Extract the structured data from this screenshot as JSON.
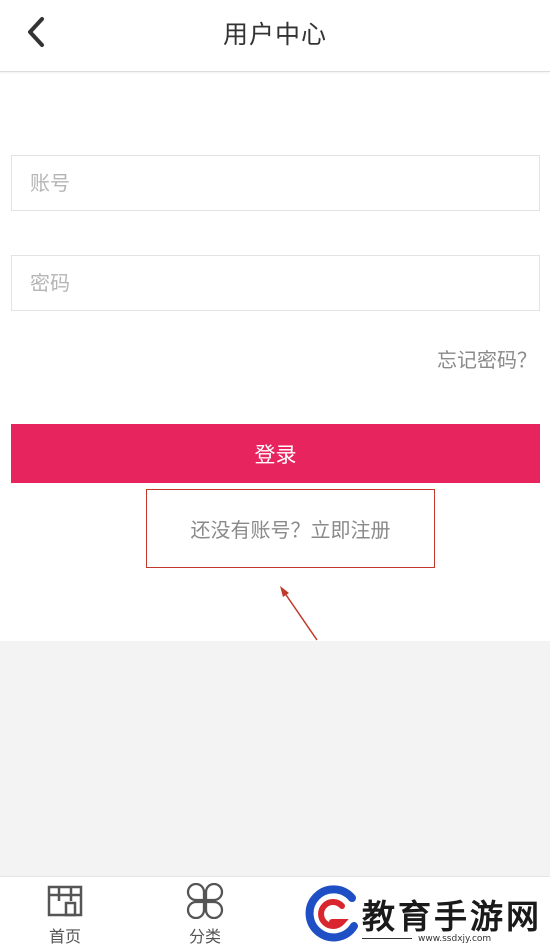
{
  "header": {
    "title": "用户中心"
  },
  "form": {
    "account_placeholder": "账号",
    "password_placeholder": "密码",
    "forgot_label": "忘记密码？",
    "login_label": "登录",
    "register_label": "还没有账号？立即注册"
  },
  "tabbar": {
    "items": [
      {
        "label": "首页",
        "icon": "store-icon"
      },
      {
        "label": "分类",
        "icon": "clover-grid-icon"
      }
    ]
  },
  "watermark": {
    "text": "教育手游网",
    "url": "www.ssdxjy.com"
  },
  "colors": {
    "accent": "#e8245f",
    "highlight_box": "#c0392b",
    "watermark_blue": "#1f4fc4",
    "watermark_red": "#d9262e"
  }
}
